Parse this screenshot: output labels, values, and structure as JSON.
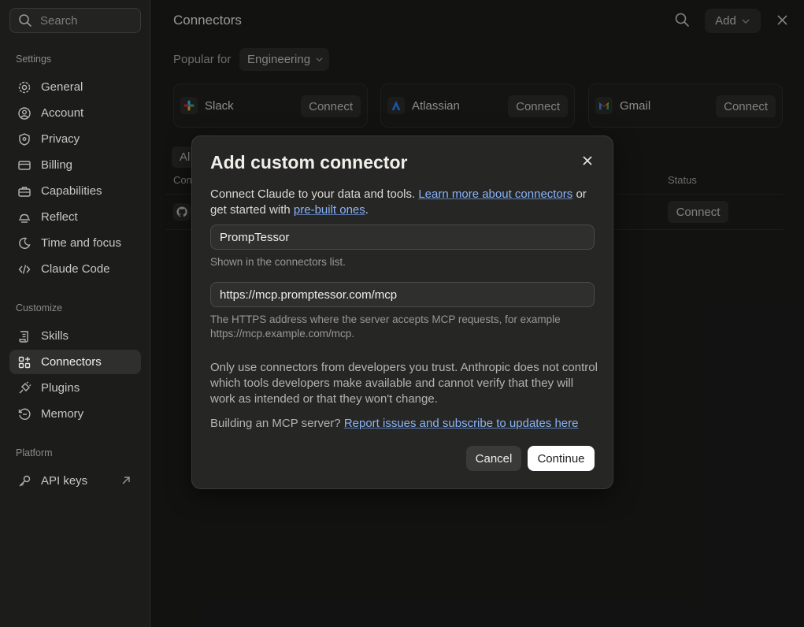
{
  "sidebar": {
    "search_placeholder": "Search",
    "sections": {
      "settings": "Settings",
      "customize": "Customize",
      "platform": "Platform"
    },
    "items": [
      {
        "label": "General",
        "icon": "gear-icon"
      },
      {
        "label": "Account",
        "icon": "user-circle-icon"
      },
      {
        "label": "Privacy",
        "icon": "shield-icon"
      },
      {
        "label": "Billing",
        "icon": "card-icon"
      },
      {
        "label": "Capabilities",
        "icon": "briefcase-icon"
      },
      {
        "label": "Reflect",
        "icon": "sunrise-icon"
      },
      {
        "label": "Time and focus",
        "icon": "moon-icon"
      },
      {
        "label": "Claude Code",
        "icon": "code-icon"
      },
      {
        "label": "Skills",
        "icon": "scroll-icon"
      },
      {
        "label": "Connectors",
        "icon": "grid-plus-icon",
        "active": true
      },
      {
        "label": "Plugins",
        "icon": "plug-icon"
      },
      {
        "label": "Memory",
        "icon": "history-icon"
      },
      {
        "label": "API keys",
        "icon": "key-icon"
      }
    ]
  },
  "main": {
    "title": "Connectors",
    "add_label": "Add",
    "popular_label": "Popular for",
    "popular_value": "Engineering",
    "cards": [
      {
        "name": "Slack",
        "action": "Connect",
        "icon": "slack-icon"
      },
      {
        "name": "Atlassian",
        "action": "Connect",
        "icon": "atlassian-icon"
      },
      {
        "name": "Gmail",
        "action": "Connect",
        "icon": "gmail-icon"
      }
    ],
    "tab_fragment": "Al",
    "column_fragment": "Con",
    "status_header": "Status",
    "row_action": "Connect"
  },
  "modal": {
    "title": "Add custom connector",
    "intro_text": "Connect Claude to your data and tools. ",
    "intro_link1": "Learn more about connectors",
    "intro_mid": " or get started with ",
    "intro_link2": "pre-built ones",
    "intro_end": ".",
    "name_value": "PrompTessor",
    "name_help": "Shown in the connectors list.",
    "url_value": "https://mcp.promptessor.com/mcp",
    "url_help": "The HTTPS address where the server accepts MCP requests, for example https://mcp.example.com/mcp.",
    "warning": "Only use connectors from developers you trust. Anthropic does not control which tools developers make available and cannot verify that they will work as intended or that they won't change.",
    "build_text": "Building an MCP server? ",
    "build_link": "Report issues and subscribe to updates here",
    "cancel_label": "Cancel",
    "continue_label": "Continue"
  }
}
